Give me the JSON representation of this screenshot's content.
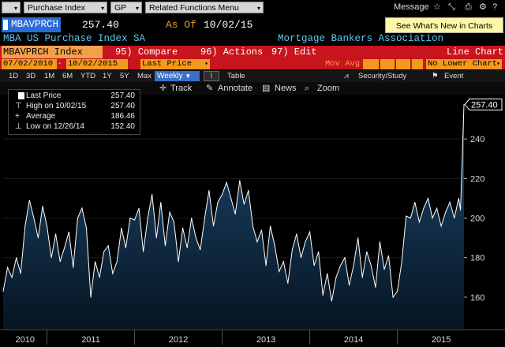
{
  "topbar": {
    "security_menu": "Purchase Index",
    "gp_menu": "GP",
    "related_menu": "Related Functions Menu",
    "message_label": "Message",
    "star_icon": "star-icon",
    "resize_icon": "resize-icon",
    "print_icon": "print-icon",
    "gear_icon": "gear-icon",
    "help_icon": "help-icon"
  },
  "security": {
    "ticker": "MBAVPRCH",
    "last_price": "257.40",
    "as_of_label": "As Of",
    "as_of_date": "10/02/15",
    "whats_new": "See What's New in Charts"
  },
  "description": {
    "name": "MBA US Purchase Index SA",
    "source": "Mortgage Bankers Association"
  },
  "toolbar": {
    "ticker_field": "MBAVPRCH Index",
    "compare": "95) Compare",
    "actions": "96) Actions",
    "edit": "97) Edit",
    "chart_type": "Line Chart"
  },
  "daterow": {
    "start_date": "07/02/2010",
    "end_date": "10/02/2015",
    "field": "Last Price",
    "mov_avg_label": "Mov Avg",
    "lower_chart": "No Lower Chart"
  },
  "periods": [
    "1D",
    "3D",
    "1M",
    "6M",
    "YTD",
    "1Y",
    "5Y",
    "Max"
  ],
  "frequency": "Weekly",
  "table_label": "Table",
  "security_study": "Security/Study",
  "event_label": "Event",
  "tools": {
    "track": "Track",
    "annotate": "Annotate",
    "news": "News",
    "zoom": "Zoom"
  },
  "legend": {
    "rows": [
      {
        "label": "Last Price",
        "value": "257.40"
      },
      {
        "label": "High on 10/02/15",
        "value": "257.40"
      },
      {
        "label": "Average",
        "value": "186.46"
      },
      {
        "label": "Low on 12/26/14",
        "value": "152.40"
      }
    ]
  },
  "colors": {
    "background": "#000000",
    "line": "#ffffff",
    "area_top": "#1f4a73",
    "area_bottom": "#061522",
    "accent_amber": "#f39a1d",
    "toolbar_red": "#c8141c",
    "ticker_blue": "#2a6cd6",
    "desc_cyan": "#5cc8f0"
  },
  "chart_data": {
    "type": "area",
    "title": "",
    "xlabel": "",
    "ylabel": "",
    "ylim": [
      144,
      262
    ],
    "xlim": [
      2010.5,
      2015.76
    ],
    "y_ticks": [
      160,
      180,
      200,
      220,
      240
    ],
    "x_ticks": [
      "2010",
      "2011",
      "2012",
      "2013",
      "2014",
      "2015"
    ],
    "x_tick_pos": [
      2010.75,
      2011.5,
      2012.5,
      2013.5,
      2014.5,
      2015.5
    ],
    "last_value_label": "257.40",
    "x": [
      2010.5,
      2010.55,
      2010.6,
      2010.65,
      2010.7,
      2010.75,
      2010.8,
      2010.85,
      2010.9,
      2010.95,
      2011.0,
      2011.05,
      2011.1,
      2011.15,
      2011.2,
      2011.25,
      2011.3,
      2011.35,
      2011.4,
      2011.45,
      2011.5,
      2011.55,
      2011.6,
      2011.65,
      2011.7,
      2011.75,
      2011.8,
      2011.85,
      2011.9,
      2011.95,
      2012.0,
      2012.05,
      2012.1,
      2012.15,
      2012.2,
      2012.25,
      2012.3,
      2012.35,
      2012.4,
      2012.45,
      2012.5,
      2012.55,
      2012.6,
      2012.65,
      2012.7,
      2012.75,
      2012.8,
      2012.85,
      2012.9,
      2012.95,
      2013.0,
      2013.05,
      2013.1,
      2013.15,
      2013.2,
      2013.25,
      2013.3,
      2013.35,
      2013.4,
      2013.45,
      2013.5,
      2013.55,
      2013.6,
      2013.65,
      2013.7,
      2013.75,
      2013.8,
      2013.85,
      2013.9,
      2013.95,
      2014.0,
      2014.05,
      2014.1,
      2014.15,
      2014.2,
      2014.25,
      2014.3,
      2014.35,
      2014.4,
      2014.45,
      2014.5,
      2014.55,
      2014.6,
      2014.65,
      2014.7,
      2014.75,
      2014.8,
      2014.85,
      2014.9,
      2014.95,
      2015.0,
      2015.05,
      2015.1,
      2015.15,
      2015.2,
      2015.25,
      2015.3,
      2015.35,
      2015.4,
      2015.45,
      2015.5,
      2015.55,
      2015.6,
      2015.65,
      2015.7,
      2015.72,
      2015.74,
      2015.76
    ],
    "values": [
      163,
      175,
      170,
      180,
      172,
      196,
      209,
      200,
      190,
      206,
      196,
      180,
      192,
      178,
      185,
      193,
      175,
      200,
      205,
      195,
      160,
      178,
      170,
      183,
      186,
      172,
      178,
      195,
      185,
      200,
      199,
      205,
      183,
      200,
      212,
      190,
      208,
      186,
      203,
      198,
      178,
      195,
      185,
      200,
      190,
      184,
      200,
      214,
      196,
      208,
      212,
      218,
      210,
      202,
      219,
      207,
      214,
      196,
      188,
      194,
      176,
      196,
      186,
      173,
      178,
      167,
      184,
      192,
      180,
      188,
      193,
      176,
      183,
      161,
      172,
      158,
      170,
      176,
      180,
      166,
      176,
      190,
      170,
      183,
      176,
      165,
      188,
      174,
      181,
      160,
      163,
      178,
      201,
      200,
      208,
      198,
      205,
      210,
      200,
      205,
      196,
      203,
      208,
      200,
      210,
      204,
      230,
      257.4
    ]
  }
}
